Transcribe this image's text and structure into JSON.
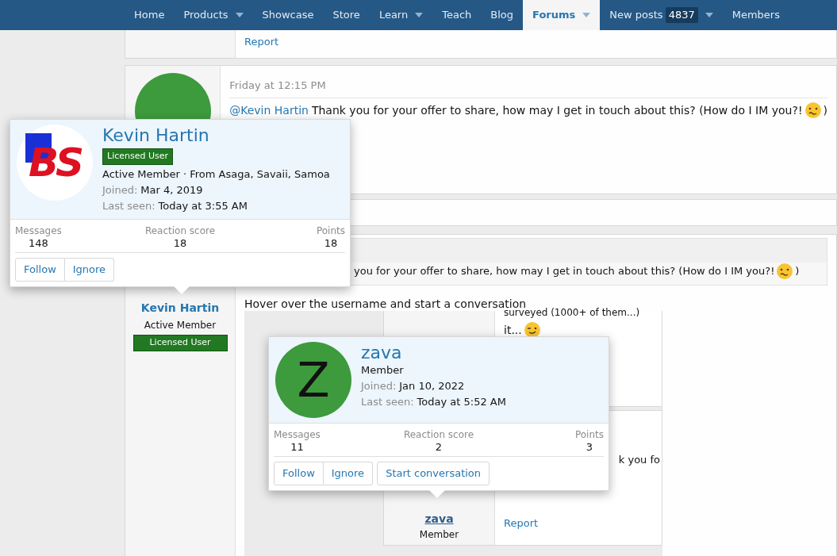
{
  "nav": {
    "items": [
      {
        "label": "Home",
        "selected": false,
        "dropdown": false
      },
      {
        "label": "Products",
        "selected": false,
        "dropdown": true
      },
      {
        "label": "Showcase",
        "selected": false,
        "dropdown": false
      },
      {
        "label": "Store",
        "selected": false,
        "dropdown": false
      },
      {
        "label": "Learn",
        "selected": false,
        "dropdown": true
      },
      {
        "label": "Teach",
        "selected": false,
        "dropdown": false
      },
      {
        "label": "Blog",
        "selected": false,
        "dropdown": false
      },
      {
        "label": "Forums",
        "selected": true,
        "dropdown": true
      },
      {
        "label": "New posts",
        "badge": "4837",
        "selected": false,
        "dropdown": true
      },
      {
        "label": "Members",
        "selected": false,
        "dropdown": false
      }
    ]
  },
  "post_top": {
    "report": "Report"
  },
  "post_reply": {
    "time": "Friday at 12:15 PM",
    "mention": "@Kevin Hartin",
    "text": "Thank you for your offer to share, how may I get in touch about this? (How do I IM you?!",
    "text_end": ")"
  },
  "post_answer": {
    "author": {
      "name": "Kevin Hartin",
      "title": "Active Member",
      "banner": "Licensed User"
    },
    "quote_text": "you for your offer to share, how may I get in touch about this? (How do I IM you?!",
    "quote_end": ")",
    "text": "Hover over the username and start a conversation",
    "embedded_screenshot": {
      "line_1": "surveyed (1000+ of them...)",
      "line_2": "it...",
      "line_3": "k you fo",
      "author_name": "zava",
      "author_title": "Member",
      "report": "Report"
    }
  },
  "cards": [
    {
      "avatar": {
        "kind": "logo",
        "text": "BS"
      },
      "name": "Kevin Hartin",
      "banner": "Licensed User",
      "info": "Active Member · From Asaga, Savaii, Samoa",
      "joined_label": "Joined:",
      "joined": "Mar 4, 2019",
      "last_seen_label": "Last seen:",
      "last_seen": "Today at 3:55 AM",
      "stats": [
        {
          "label": "Messages",
          "value": "148"
        },
        {
          "label": "Reaction score",
          "value": "18"
        },
        {
          "label": "Points",
          "value": "18"
        }
      ],
      "buttons": [
        "Follow",
        "Ignore"
      ]
    },
    {
      "avatar": {
        "kind": "letter",
        "text": "Z"
      },
      "name": "zava",
      "info": "Member",
      "joined_label": "Joined:",
      "joined": "Jan 10, 2022",
      "last_seen_label": "Last seen:",
      "last_seen": "Today at 5:52 AM",
      "stats": [
        {
          "label": "Messages",
          "value": "11"
        },
        {
          "label": "Reaction score",
          "value": "2"
        },
        {
          "label": "Points",
          "value": "3"
        }
      ],
      "buttons": [
        "Follow",
        "Ignore",
        "Start conversation"
      ]
    }
  ]
}
